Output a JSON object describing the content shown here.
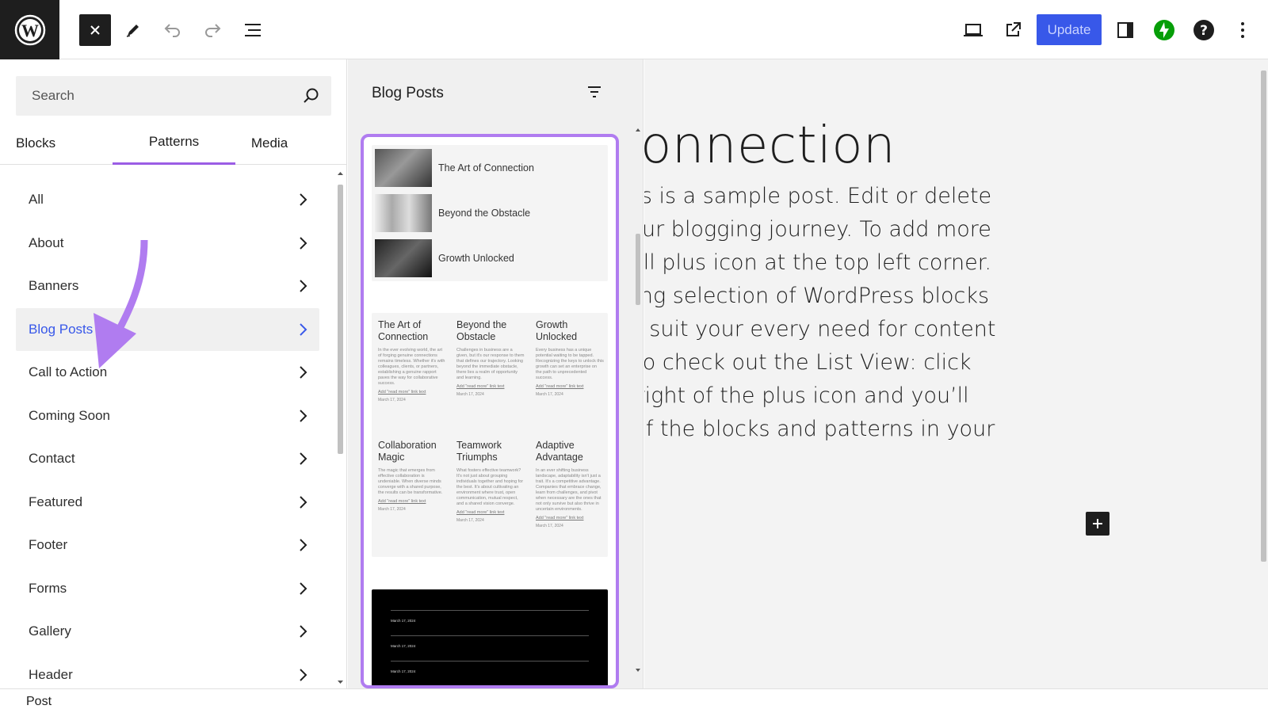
{
  "toolbar": {
    "update_label": "Update",
    "icons": [
      "wordpress-logo",
      "close",
      "pencil",
      "undo",
      "redo",
      "list-view",
      "laptop-preview",
      "external-link",
      "sidebar-toggle",
      "jetpack-bolt",
      "help",
      "more-vertical"
    ]
  },
  "inserter": {
    "search_placeholder": "Search",
    "tabs": [
      {
        "label": "Blocks"
      },
      {
        "label": "Patterns"
      },
      {
        "label": "Media"
      }
    ],
    "active_tab": "Patterns",
    "categories": [
      {
        "label": "All"
      },
      {
        "label": "About"
      },
      {
        "label": "Banners"
      },
      {
        "label": "Blog Posts"
      },
      {
        "label": "Call to Action"
      },
      {
        "label": "Coming Soon"
      },
      {
        "label": "Contact"
      },
      {
        "label": "Featured"
      },
      {
        "label": "Footer"
      },
      {
        "label": "Forms"
      },
      {
        "label": "Gallery"
      },
      {
        "label": "Header"
      }
    ],
    "active_category": "Blog Posts"
  },
  "patterns": {
    "title": "Blog Posts",
    "card1": [
      {
        "title": "The Art of Connection"
      },
      {
        "title": "Beyond the Obstacle"
      },
      {
        "title": "Growth Unlocked"
      }
    ],
    "card2": [
      {
        "title": "The Art of Connection",
        "body": "In the ever evolving world, the art of forging genuine connections remains timeless. Whether it's with colleagues, clients, or partners, establishing a genuine rapport paves the way for collaborative success.",
        "link": "Add \"read more\" link text",
        "date": "March 17, 2024"
      },
      {
        "title": "Beyond the Obstacle",
        "body": "Challenges in business are a given, but it's our response to them that defines our trajectory. Looking beyond the immediate obstacle, there lies a realm of opportunity and learning.",
        "link": "Add \"read more\" link text",
        "date": "March 17, 2024"
      },
      {
        "title": "Growth Unlocked",
        "body": "Every business has a unique potential waiting to be tapped. Recognizing the keys to unlock this growth can set an enterprise on the path to unprecedented success.",
        "link": "Add \"read more\" link text",
        "date": "March 17, 2024"
      },
      {
        "title": "Collaboration Magic",
        "body": "The magic that emerges from effective collaboration is undeniable. When diverse minds converge with a shared purpose, the results can be transformative.",
        "link": "Add \"read more\" link text",
        "date": "March 17, 2024"
      },
      {
        "title": "Teamwork Triumphs",
        "body": "What fosters effective teamwork? It's not just about grouping individuals together and hoping for the best. It's about cultivating an environment where trust, open communication, mutual respect, and a shared vision converge.",
        "link": "Add \"read more\" link text",
        "date": "March 17, 2024"
      },
      {
        "title": "Adaptive Advantage",
        "body": "In an ever shifting business landscape, adaptability isn't just a trait. It's a competitive advantage. Companies that embrace change, learn from challenges, and pivot when necessary are the ones that not only survive but also thrive in uncertain environments.",
        "link": "Add \"read more\" link text",
        "date": "March 17, 2024"
      }
    ],
    "card3_dates": [
      "March 17, 2024",
      "March 17, 2024",
      "March 17, 2024"
    ]
  },
  "canvas": {
    "title": "t of Connection",
    "lines": [
      "ordPress! This is a sample post. Edit or delete",
      "rst step in your blogging journey. To add more",
      "click the small plus icon at the top left corner.",
      "find an existing selection of WordPress blocks",
      "something to suit your every need for content",
      "don’t forget to check out the List View: click",
      "spots to the right of the plus icon and you’ll",
      "-to-view list of the blocks and patterns in your"
    ]
  },
  "footer": {
    "breadcrumb": "Post"
  },
  "colors": {
    "accent": "#3858e9",
    "annotation": "#b07cf0",
    "jetpack": "#069e08"
  }
}
